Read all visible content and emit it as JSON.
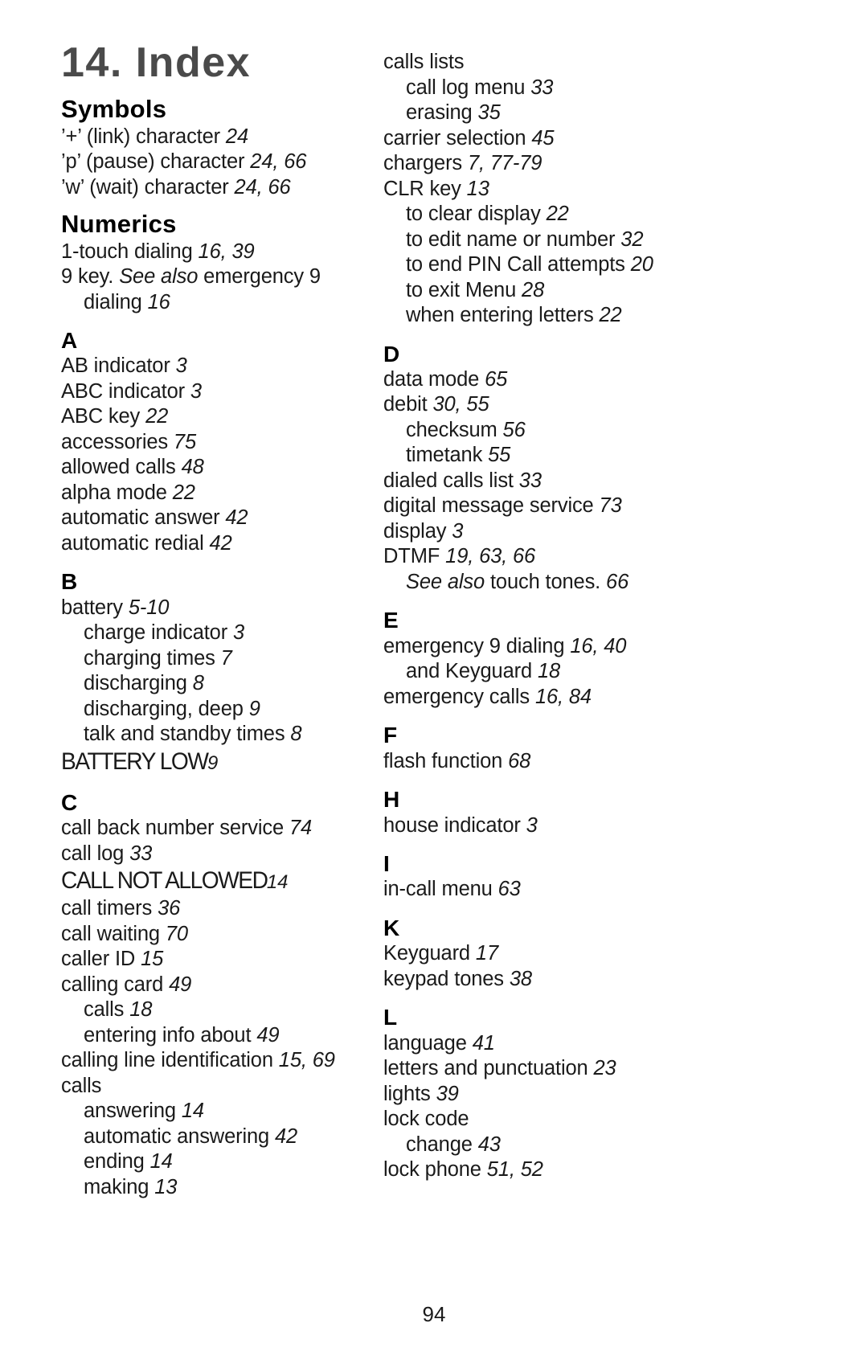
{
  "page": {
    "chapter_title": "14. Index",
    "folio": "94"
  },
  "left_column": {
    "groups": [
      {
        "heading": "Symbols",
        "heading_style": "word",
        "entries": [
          {
            "level": 1,
            "text": "’+’ (link) character ",
            "pages": "24"
          },
          {
            "level": 1,
            "text": "’p’ (pause) character ",
            "pages": "24, 66"
          },
          {
            "level": 1,
            "text": "’w’ (wait) character ",
            "pages": "24, 66"
          }
        ]
      },
      {
        "heading": "Numerics",
        "heading_style": "word",
        "entries": [
          {
            "level": 1,
            "text": "1-touch dialing ",
            "pages": "16, 39"
          },
          {
            "level": 1,
            "text": "9 key. ",
            "italic": "See also",
            "text2": " emergency 9",
            "pages": ""
          },
          {
            "level": 2,
            "text": "dialing ",
            "pages": "16"
          }
        ]
      },
      {
        "heading": "A",
        "heading_style": "letter",
        "entries": [
          {
            "level": 1,
            "text": "AB indicator ",
            "pages": "3"
          },
          {
            "level": 1,
            "text": "ABC indicator ",
            "pages": "3"
          },
          {
            "level": 1,
            "text": "ABC key ",
            "pages": "22"
          },
          {
            "level": 1,
            "text": "accessories ",
            "pages": "75"
          },
          {
            "level": 1,
            "text": "allowed calls ",
            "pages": "48"
          },
          {
            "level": 1,
            "text": "alpha mode ",
            "pages": "22"
          },
          {
            "level": 1,
            "text": "automatic answer ",
            "pages": "42"
          },
          {
            "level": 1,
            "text": "automatic redial ",
            "pages": "42"
          }
        ]
      },
      {
        "heading": "B",
        "heading_style": "letter",
        "entries": [
          {
            "level": 1,
            "text": "battery ",
            "pages": "5-10"
          },
          {
            "level": 2,
            "text": "charge indicator ",
            "pages": "3"
          },
          {
            "level": 2,
            "text": "charging times ",
            "pages": "7"
          },
          {
            "level": 2,
            "text": "discharging ",
            "pages": "8"
          },
          {
            "level": 2,
            "text": "discharging, deep ",
            "pages": "9"
          },
          {
            "level": 2,
            "text": "talk and standby times ",
            "pages": "8"
          },
          {
            "level": 1,
            "display": true,
            "text": "BATTERY LOW",
            "pages": "9"
          }
        ]
      },
      {
        "heading": "C",
        "heading_style": "letter",
        "entries": [
          {
            "level": 1,
            "text": "call back number service ",
            "pages": "74"
          },
          {
            "level": 1,
            "text": "call log ",
            "pages": "33"
          },
          {
            "level": 1,
            "display": true,
            "text": "CALL NOT ALLOWED",
            "pages": " 14"
          },
          {
            "level": 1,
            "text": "call timers ",
            "pages": "36"
          },
          {
            "level": 1,
            "text": "call waiting ",
            "pages": "70"
          },
          {
            "level": 1,
            "text": "caller ID ",
            "pages": "15"
          },
          {
            "level": 1,
            "text": "calling card ",
            "pages": "49"
          },
          {
            "level": 2,
            "text": "calls ",
            "pages": "18"
          },
          {
            "level": 2,
            "text": "entering info about ",
            "pages": "49"
          },
          {
            "level": 1,
            "text": "calling line identification ",
            "pages": "15, 69"
          },
          {
            "level": 1,
            "text": "calls",
            "pages": ""
          },
          {
            "level": 2,
            "text": "answering ",
            "pages": "14"
          },
          {
            "level": 2,
            "text": "automatic answering ",
            "pages": "42"
          },
          {
            "level": 2,
            "text": "ending ",
            "pages": "14"
          },
          {
            "level": 2,
            "text": "making ",
            "pages": "13"
          }
        ]
      }
    ]
  },
  "right_column": {
    "groups": [
      {
        "heading": "",
        "heading_style": "none",
        "entries": [
          {
            "level": 1,
            "text": "calls lists",
            "pages": ""
          },
          {
            "level": 2,
            "text": "call log menu ",
            "pages": "33"
          },
          {
            "level": 2,
            "text": "erasing ",
            "pages": "35"
          },
          {
            "level": 1,
            "text": "carrier selection ",
            "pages": "45"
          },
          {
            "level": 1,
            "text": "chargers ",
            "pages": "7, 77-79"
          },
          {
            "level": 1,
            "text": "CLR key ",
            "pages": "13"
          },
          {
            "level": 2,
            "text": "to clear display ",
            "pages": "22"
          },
          {
            "level": 2,
            "text": "to edit name or number ",
            "pages": "32"
          },
          {
            "level": 2,
            "text": "to end PIN Call attempts ",
            "pages": "20"
          },
          {
            "level": 2,
            "text": "to exit Menu ",
            "pages": "28"
          },
          {
            "level": 2,
            "text": "when entering letters ",
            "pages": "22"
          }
        ]
      },
      {
        "heading": "D",
        "heading_style": "letter",
        "entries": [
          {
            "level": 1,
            "text": "data mode ",
            "pages": "65"
          },
          {
            "level": 1,
            "text": "debit ",
            "pages": "30, 55"
          },
          {
            "level": 2,
            "text": "checksum ",
            "pages": "56"
          },
          {
            "level": 2,
            "text": "timetank ",
            "pages": "55"
          },
          {
            "level": 1,
            "text": "dialed calls list ",
            "pages": "33"
          },
          {
            "level": 1,
            "text": "digital message service ",
            "pages": "73"
          },
          {
            "level": 1,
            "text": "display ",
            "pages": "3"
          },
          {
            "level": 1,
            "text": "DTMF ",
            "pages": "19, 63, 66"
          },
          {
            "level": 2,
            "italic": "See also",
            "text2": " touch tones. ",
            "pages": "66",
            "text": ""
          }
        ]
      },
      {
        "heading": "E",
        "heading_style": "letter",
        "entries": [
          {
            "level": 1,
            "text": "emergency 9 dialing ",
            "pages": "16, 40"
          },
          {
            "level": 2,
            "text": "and Keyguard ",
            "pages": "18"
          },
          {
            "level": 1,
            "text": "emergency calls ",
            "pages": "16, 84"
          }
        ]
      },
      {
        "heading": "F",
        "heading_style": "letter",
        "entries": [
          {
            "level": 1,
            "text": "flash function ",
            "pages": "68"
          }
        ]
      },
      {
        "heading": "H",
        "heading_style": "letter",
        "entries": [
          {
            "level": 1,
            "text": "house indicator ",
            "pages": "3"
          }
        ]
      },
      {
        "heading": "I",
        "heading_style": "letter",
        "entries": [
          {
            "level": 1,
            "text": "in-call menu ",
            "pages": "63"
          }
        ]
      },
      {
        "heading": "K",
        "heading_style": "letter",
        "entries": [
          {
            "level": 1,
            "text": "Keyguard ",
            "pages": "17"
          },
          {
            "level": 1,
            "text": "keypad tones ",
            "pages": "38"
          }
        ]
      },
      {
        "heading": "L",
        "heading_style": "letter",
        "entries": [
          {
            "level": 1,
            "text": "language ",
            "pages": "41"
          },
          {
            "level": 1,
            "text": "letters and punctuation ",
            "pages": "23"
          },
          {
            "level": 1,
            "text": "lights ",
            "pages": "39"
          },
          {
            "level": 1,
            "text": "lock code",
            "pages": ""
          },
          {
            "level": 2,
            "text": "change ",
            "pages": "43"
          },
          {
            "level": 1,
            "text": "lock phone ",
            "pages": "51, 52"
          }
        ]
      }
    ]
  }
}
